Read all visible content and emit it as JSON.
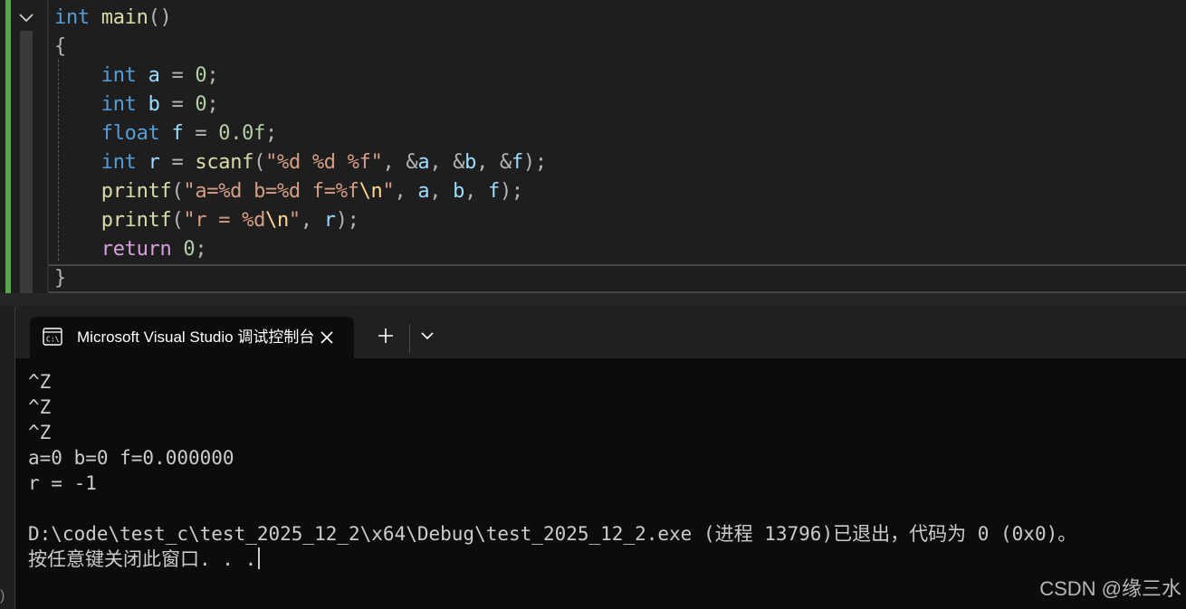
{
  "editor": {
    "lines": [
      {
        "tokens": [
          {
            "c": "kw",
            "t": "int"
          },
          {
            "c": "",
            "t": " "
          },
          {
            "c": "fn",
            "t": "main"
          },
          {
            "c": "pun",
            "t": "()"
          }
        ]
      },
      {
        "tokens": [
          {
            "c": "pun",
            "t": "{"
          }
        ]
      },
      {
        "tokens": [
          {
            "c": "",
            "t": "    "
          },
          {
            "c": "kw",
            "t": "int"
          },
          {
            "c": "",
            "t": " "
          },
          {
            "c": "var",
            "t": "a"
          },
          {
            "c": "pun",
            "t": " = "
          },
          {
            "c": "num",
            "t": "0"
          },
          {
            "c": "pun",
            "t": ";"
          }
        ]
      },
      {
        "tokens": [
          {
            "c": "",
            "t": "    "
          },
          {
            "c": "kw",
            "t": "int"
          },
          {
            "c": "",
            "t": " "
          },
          {
            "c": "var",
            "t": "b"
          },
          {
            "c": "pun",
            "t": " = "
          },
          {
            "c": "num",
            "t": "0"
          },
          {
            "c": "pun",
            "t": ";"
          }
        ]
      },
      {
        "tokens": [
          {
            "c": "",
            "t": "    "
          },
          {
            "c": "kw",
            "t": "float"
          },
          {
            "c": "",
            "t": " "
          },
          {
            "c": "var",
            "t": "f"
          },
          {
            "c": "pun",
            "t": " = "
          },
          {
            "c": "num",
            "t": "0.0f"
          },
          {
            "c": "pun",
            "t": ";"
          }
        ]
      },
      {
        "tokens": [
          {
            "c": "",
            "t": "    "
          },
          {
            "c": "kw",
            "t": "int"
          },
          {
            "c": "",
            "t": " "
          },
          {
            "c": "var",
            "t": "r"
          },
          {
            "c": "pun",
            "t": " = "
          },
          {
            "c": "fn",
            "t": "scanf"
          },
          {
            "c": "pun",
            "t": "("
          },
          {
            "c": "str",
            "t": "\"%d %d %f\""
          },
          {
            "c": "pun",
            "t": ", &"
          },
          {
            "c": "var",
            "t": "a"
          },
          {
            "c": "pun",
            "t": ", &"
          },
          {
            "c": "var",
            "t": "b"
          },
          {
            "c": "pun",
            "t": ", &"
          },
          {
            "c": "var",
            "t": "f"
          },
          {
            "c": "pun",
            "t": ");"
          }
        ]
      },
      {
        "tokens": [
          {
            "c": "",
            "t": "    "
          },
          {
            "c": "fn",
            "t": "printf"
          },
          {
            "c": "pun",
            "t": "("
          },
          {
            "c": "str",
            "t": "\"a=%d b=%d f=%f"
          },
          {
            "c": "esc",
            "t": "\\n"
          },
          {
            "c": "str",
            "t": "\""
          },
          {
            "c": "pun",
            "t": ", "
          },
          {
            "c": "var",
            "t": "a"
          },
          {
            "c": "pun",
            "t": ", "
          },
          {
            "c": "var",
            "t": "b"
          },
          {
            "c": "pun",
            "t": ", "
          },
          {
            "c": "var",
            "t": "f"
          },
          {
            "c": "pun",
            "t": ");"
          }
        ]
      },
      {
        "tokens": [
          {
            "c": "",
            "t": "    "
          },
          {
            "c": "fn",
            "t": "printf"
          },
          {
            "c": "pun",
            "t": "("
          },
          {
            "c": "str",
            "t": "\"r = %d"
          },
          {
            "c": "esc",
            "t": "\\n"
          },
          {
            "c": "str",
            "t": "\""
          },
          {
            "c": "pun",
            "t": ", "
          },
          {
            "c": "var",
            "t": "r"
          },
          {
            "c": "pun",
            "t": ");"
          }
        ]
      },
      {
        "tokens": [
          {
            "c": "",
            "t": "    "
          },
          {
            "c": "ctl",
            "t": "return"
          },
          {
            "c": "",
            "t": " "
          },
          {
            "c": "num",
            "t": "0"
          },
          {
            "c": "pun",
            "t": ";"
          }
        ]
      },
      {
        "tokens": [
          {
            "c": "pun",
            "t": "}"
          }
        ]
      }
    ]
  },
  "terminal": {
    "tab_title": "Microsoft Visual Studio 调试控制台",
    "lines": [
      "^Z",
      "^Z",
      "^Z",
      "a=0 b=0 f=0.000000",
      "r = -1",
      "",
      "D:\\code\\test_c\\test_2025_12_2\\x64\\Debug\\test_2025_12_2.exe (进程 13796)已退出，代码为 0 (0x0)。",
      "按任意键关闭此窗口. . ."
    ]
  },
  "watermark": "CSDN @缘三水",
  "status_fragment": ") 未"
}
